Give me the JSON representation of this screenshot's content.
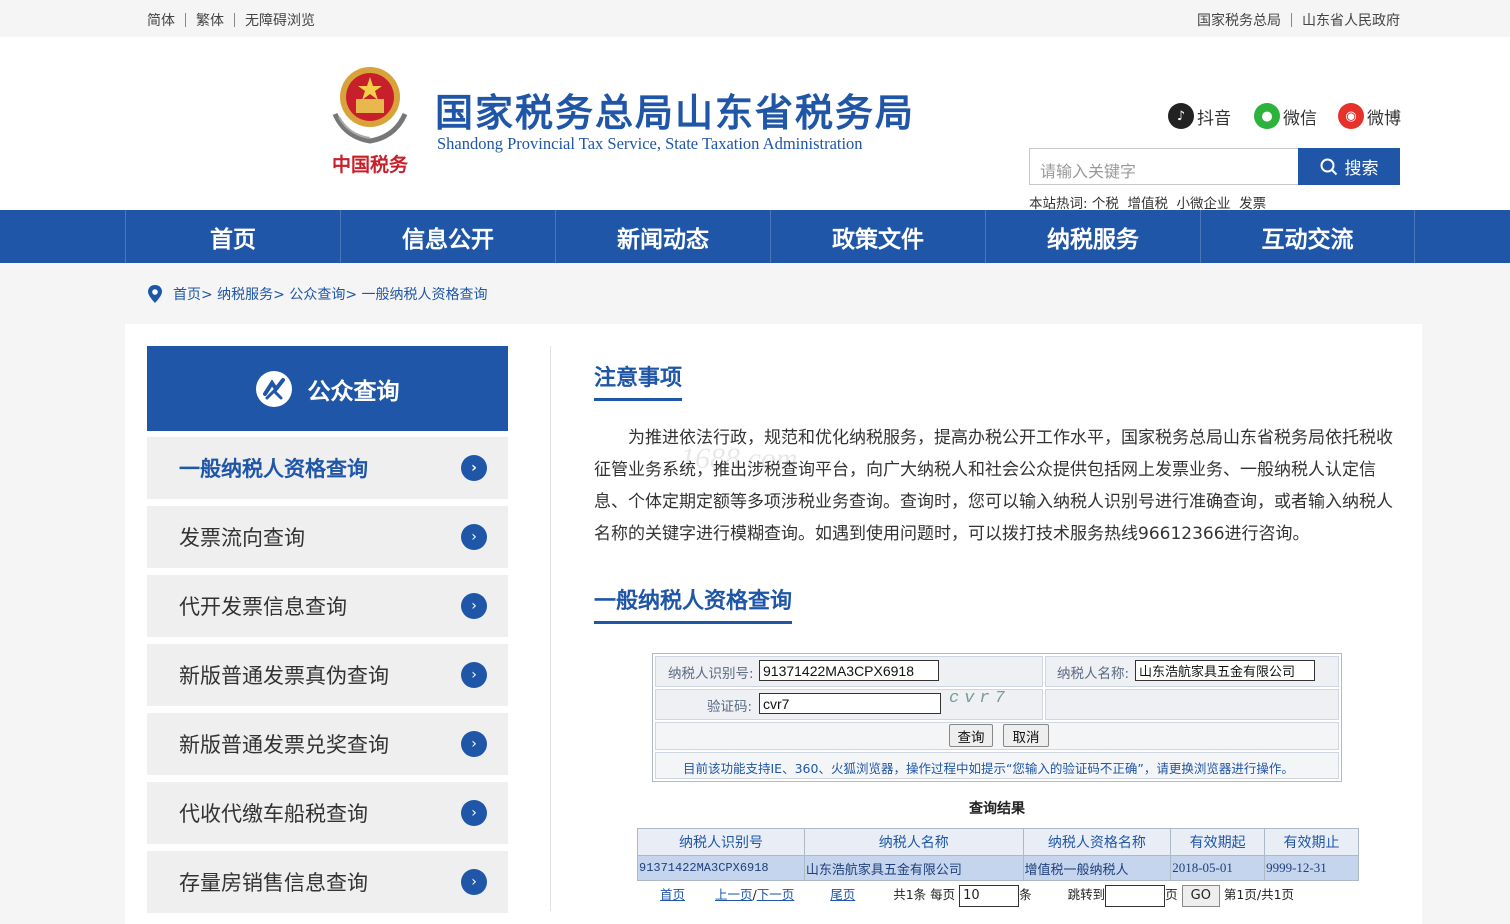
{
  "topbar": {
    "left": [
      "简体",
      "繁体",
      "无障碍浏览"
    ],
    "right": [
      "国家税务总局",
      "山东省人民政府"
    ]
  },
  "header": {
    "emblem_text": "中国税务",
    "title": "国家税务总局山东省税务局",
    "subtitle": "Shandong Provincial Tax Service, State Taxation Administration",
    "social": [
      "抖音",
      "微信",
      "微博"
    ],
    "search_placeholder": "请输入关键字",
    "search_button": "搜索",
    "hot_label": "本站热词:",
    "hot_words": "个税  增值税  小微企业  发票"
  },
  "nav": [
    "首页",
    "信息公开",
    "新闻动态",
    "政策文件",
    "纳税服务",
    "互动交流"
  ],
  "breadcrumb": "首页> 纳税服务> 公众查询> 一般纳税人资格查询",
  "sidebar": {
    "title": "公众查询",
    "items": [
      "一般纳税人资格查询",
      "发票流向查询",
      "代开发票信息查询",
      "新版普通发票真伪查询",
      "新版普通发票兑奖查询",
      "代收代缴车船税查询",
      "存量房销售信息查询"
    ],
    "arrow": "›"
  },
  "main": {
    "notice_title": "注意事项",
    "notice_text": "为推进依法行政，规范和优化纳税服务，提高办税公开工作水平，国家税务总局山东省税务局依托税收征管业务系统，推出涉税查询平台，向广大纳税人和社会公众提供包括网上发票业务、一般纳税人认定信息、个体定期定额等多项涉税业务查询。查询时，您可以输入纳税人识别号进行准确查询，或者输入纳税人名称的关键字进行模糊查询。如遇到使用问题时，可以拨打技术服务热线96612366进行咨询。",
    "query_title": "一般纳税人资格查询",
    "watermark": "1688.com"
  },
  "form": {
    "taxid_label": "纳税人识别号:",
    "taxid_value": "91371422MA3CPX6918",
    "name_label": "纳税人名称:",
    "name_value": "山东浩航家具五金有限公司",
    "captcha_label": "验证码:",
    "captcha_value": "cvr7",
    "captcha_image": "cvr7",
    "query_btn": "查询",
    "cancel_btn": "取消",
    "tip": "目前该功能支持IE、360、火狐浏览器，操作过程中如提示“您输入的验证码不正确”，请更换浏览器进行操作。"
  },
  "results": {
    "title": "查询结果",
    "headers": [
      "纳税人识别号",
      "纳税人名称",
      "纳税人资格名称",
      "有效期起",
      "有效期止"
    ],
    "row": [
      "91371422MA3CPX6918",
      "山东浩航家具五金有限公司",
      "增值税一般纳税人",
      "2018-05-01",
      "9999-12-31"
    ]
  },
  "pager": {
    "first": "首页",
    "prev": "上一页",
    "slash": "/",
    "next": "下一页",
    "last": "尾页",
    "total": "共1条",
    "per_page_label": "每页",
    "per_page_value": "10",
    "per_page_unit": "条",
    "jump_label": "跳转到",
    "page_unit": "页",
    "go": "GO",
    "status": "第1页/共1页"
  },
  "colors": {
    "brand": "#1f56a8",
    "sidebar_bg": "#efefef",
    "result_row": "#c5d5ee"
  }
}
